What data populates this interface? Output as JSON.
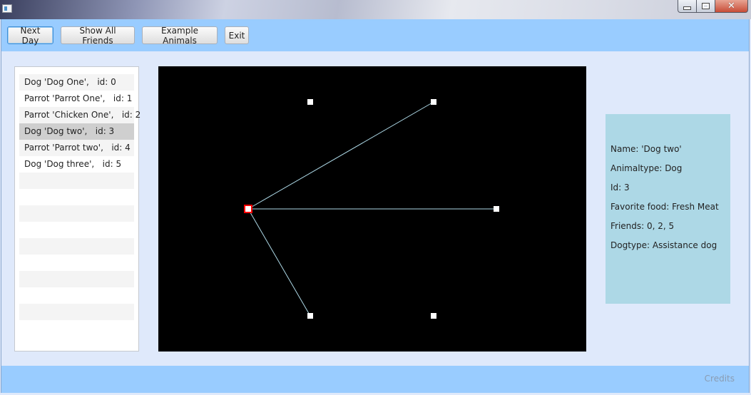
{
  "window": {
    "controls": {
      "minimize": "minimize-icon",
      "maximize": "maximize-icon",
      "close": "close-icon"
    }
  },
  "toolbar": {
    "next_day": "Next Day",
    "show_all_friends": "Show All Friends",
    "example_animals": "Example Animals",
    "exit": "Exit"
  },
  "animal_list": {
    "selected_index": 3,
    "items": [
      "Dog 'Dog One',   id: 0",
      "Parrot 'Parrot One',   id: 1",
      "Parrot 'Chicken One',   id: 2",
      "Dog 'Dog two',   id: 3",
      "Parrot 'Parrot two',   id: 4",
      "Dog 'Dog three',   id: 5"
    ]
  },
  "graph": {
    "background": "#000000",
    "node_color": "#ffffff",
    "selected_node_color": "#ff0000",
    "edge_color": "#add8e6",
    "selected_node": 3,
    "edges": [
      [
        3,
        0
      ],
      [
        3,
        2
      ],
      [
        3,
        5
      ]
    ]
  },
  "details": {
    "name": "Name: 'Dog two'",
    "animaltype": "Animaltype: Dog",
    "id": "Id: 3",
    "favorite_food": "Favorite food: Fresh Meat",
    "friends": "Friends: 0, 2, 5",
    "dogtype": "Dogtype: Assistance dog"
  },
  "footer": {
    "credits": "Credits"
  }
}
